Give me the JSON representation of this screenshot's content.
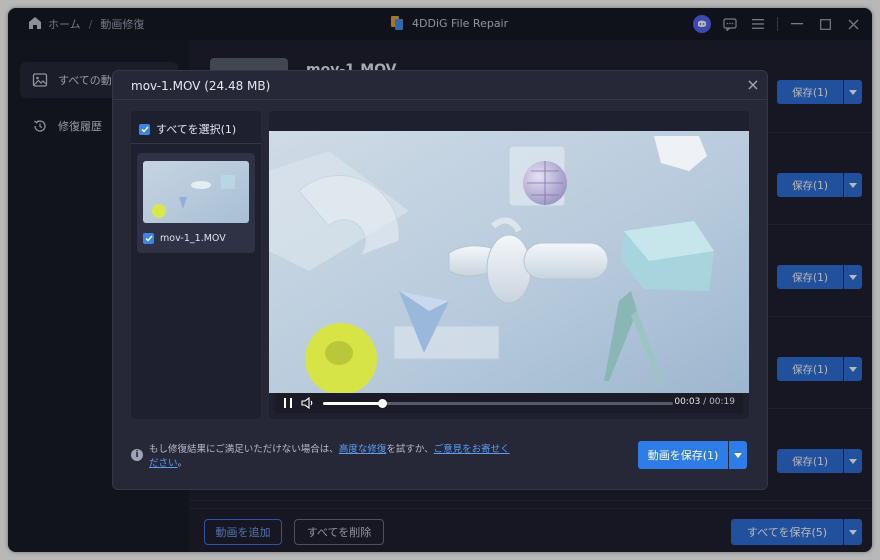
{
  "titlebar": {
    "breadcrumb_home": "ホーム",
    "breadcrumb_sep": "/",
    "breadcrumb_current": "動画修復",
    "app_title": "4DDiG File Repair",
    "icons": [
      "discord-icon",
      "feedback-icon",
      "menu-icon",
      "minimize-icon",
      "maximize-icon",
      "close-icon"
    ]
  },
  "sidebar": {
    "items": [
      {
        "label": "すべての動画",
        "icon": "image-icon",
        "active": true
      },
      {
        "label": "修復履歴",
        "icon": "history-icon",
        "active": false
      }
    ]
  },
  "main": {
    "first_file_name": "mov-1.MOV",
    "rows": [
      {
        "save_label": "保存(1)"
      },
      {
        "save_label": "保存(1)"
      },
      {
        "save_label": "保存(1)"
      },
      {
        "save_label": "保存(1)"
      },
      {
        "save_label": "保存(1)"
      }
    ],
    "add_video": "動画を追加",
    "delete_all": "すべてを削除",
    "save_all": "すべてを保存(5)"
  },
  "modal": {
    "title": "mov-1.MOV  (24.48 MB)",
    "select_all": "すべてを選択(1)",
    "clip_name": "mov-1_1.MOV",
    "player": {
      "current_time": "00:03",
      "time_sep": " / ",
      "total_time": "00:19",
      "progress": 0.168
    },
    "info": {
      "prefix": "もし修復結果にご満足いただけない場合は、",
      "link1": "高度な修復",
      "middle": "を試すか、",
      "link2": "ご意見をお寄せください",
      "suffix": "。"
    },
    "save_video": "動画を保存(1)"
  },
  "colors": {
    "accent": "#2e7ce8",
    "window_bg": "#1d1f2c",
    "modal_bg": "#262838"
  }
}
